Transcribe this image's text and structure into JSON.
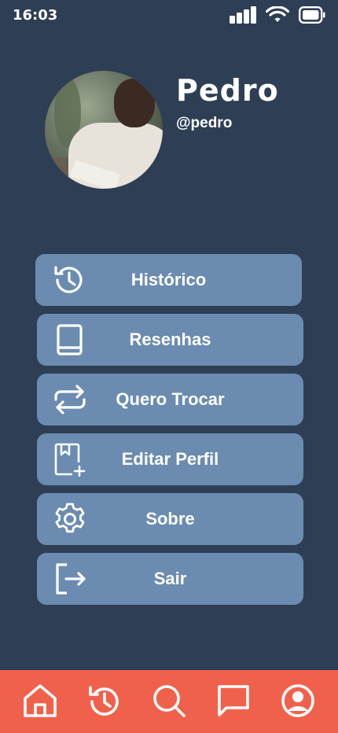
{
  "status_bar": {
    "time": "16:03",
    "icons": [
      "cellular-signal-icon",
      "wifi-icon",
      "battery-icon"
    ]
  },
  "profile": {
    "name": "Pedro",
    "handle": "@pedro",
    "avatar": "profile-photo"
  },
  "menu": {
    "items": [
      {
        "label": "Histórico",
        "icon": "history-icon"
      },
      {
        "label": "Resenhas",
        "icon": "book-icon"
      },
      {
        "label": "Quero Trocar",
        "icon": "swap-arrows-icon"
      },
      {
        "label": "Editar Perfil",
        "icon": "bookmark-add-icon"
      },
      {
        "label": "Sobre",
        "icon": "gear-icon"
      },
      {
        "label": "Sair",
        "icon": "logout-icon"
      }
    ]
  },
  "bottom_nav": {
    "items": [
      {
        "icon": "home-icon"
      },
      {
        "icon": "history-icon"
      },
      {
        "icon": "search-icon"
      },
      {
        "icon": "chat-icon"
      },
      {
        "icon": "user-icon"
      }
    ]
  },
  "colors": {
    "background": "#2e3f55",
    "menu_button": "#6b8cb0",
    "bottom_nav": "#f0614b",
    "text": "#ffffff"
  }
}
